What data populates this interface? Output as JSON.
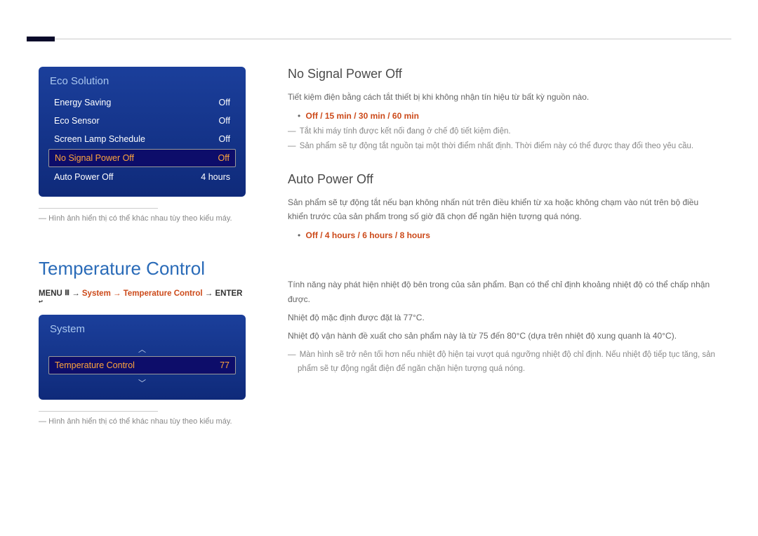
{
  "eco_menu": {
    "title": "Eco Solution",
    "rows": [
      {
        "label": "Energy Saving",
        "value": "Off",
        "selected": false
      },
      {
        "label": "Eco Sensor",
        "value": "Off",
        "selected": false
      },
      {
        "label": "Screen Lamp Schedule",
        "value": "Off",
        "selected": false
      },
      {
        "label": "No Signal Power Off",
        "value": "Off",
        "selected": true
      },
      {
        "label": "Auto Power Off",
        "value": "4 hours",
        "selected": false
      }
    ]
  },
  "note_image_vary": "Hình ảnh hiển thị có thể khác nhau tùy theo kiểu máy.",
  "no_signal": {
    "title": "No Signal Power Off",
    "desc": "Tiết kiệm điện bằng cách tắt thiết bị khi không nhận tín hiệu từ bất kỳ nguồn nào.",
    "options": "Off / 15 min / 30 min / 60 min",
    "sub1": "Tắt khi máy tính được kết nối đang ở chế độ tiết kiệm điện.",
    "sub2": "Sản phẩm sẽ tự động tắt nguồn tại một thời điểm nhất định. Thời điểm này có thể được thay đổi theo yêu cầu."
  },
  "auto_off": {
    "title": "Auto Power Off",
    "desc": "Sản phẩm sẽ tự động tắt nếu bạn không nhấn nút trên điều khiển từ xa hoặc không chạm vào nút trên bộ điều khiển trước của sản phẩm trong số giờ đã chọn để ngăn hiện tượng quá nóng.",
    "options": "Off / 4 hours / 6 hours / 8 hours"
  },
  "temp": {
    "heading": "Temperature Control",
    "breadcrumb": {
      "menu": "MENU",
      "path": "System → Temperature Control",
      "enter": "ENTER"
    },
    "menu_title": "System",
    "row_label": "Temperature Control",
    "row_value": "77",
    "p1": "Tính năng này phát hiện nhiệt độ bên trong của sản phẩm. Bạn có thể chỉ định khoảng nhiệt độ có thể chấp nhận được.",
    "p2": "Nhiệt độ mặc định được đặt là 77°C.",
    "p3": "Nhiệt độ vận hành đề xuất cho sản phẩm này là từ 75 đến 80°C (dựa trên nhiệt độ xung quanh là 40°C).",
    "p4": "Màn hình sẽ trở nên tối hơn nếu nhiệt độ hiện tại vượt quá ngưỡng nhiệt độ chỉ định. Nếu nhiệt độ tiếp tục tăng, sản phẩm sẽ tự động ngắt điện để ngăn chặn hiện tượng quá nóng."
  },
  "icons": {
    "menu_glyph": "Ⅲ",
    "enter_glyph": "↩",
    "up": "︿",
    "down": "﹀"
  }
}
